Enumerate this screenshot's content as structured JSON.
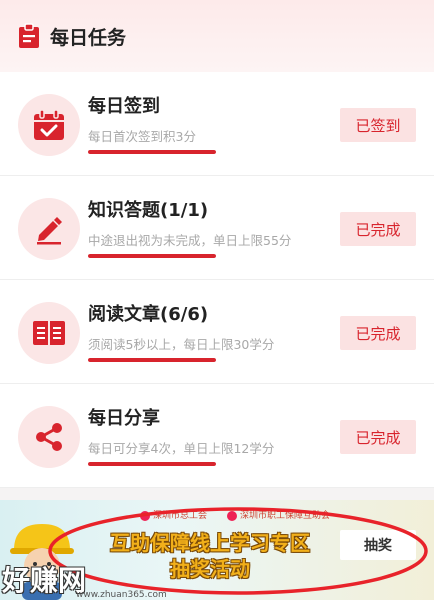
{
  "header": {
    "title": "每日任务",
    "icon": "clipboard-icon"
  },
  "tasks": [
    {
      "id": "checkin",
      "name": "每日签到",
      "desc": "每日首次签到积3分",
      "button": "已签到",
      "icon": "calendar-check-icon",
      "progress": 1
    },
    {
      "id": "quiz",
      "name": "知识答题(1/1)",
      "desc": "中途退出视为未完成，单日上限55分",
      "button": "已完成",
      "icon": "pencil-icon",
      "progress": 1
    },
    {
      "id": "reading",
      "name": "阅读文章(6/6)",
      "desc": "须阅读5秒以上，每日上限30学分",
      "button": "已完成",
      "icon": "book-icon",
      "progress": 1
    },
    {
      "id": "share",
      "name": "每日分享",
      "desc": "每日可分享4次，单日上限12学分",
      "button": "已完成",
      "icon": "share-icon",
      "progress": 1
    }
  ],
  "banner": {
    "org1": "深圳市总工会",
    "org2": "深圳市职工保障互助会",
    "line1": "互助保障线上学习专区",
    "line2": "抽奖活动",
    "button": "抽奖",
    "watermark": "好赚网",
    "watermark_url": "www.zhuan365.com"
  },
  "colors": {
    "accent": "#d8242d",
    "button_bg": "#fbe2e2",
    "icon_bg": "#fbe6e6"
  }
}
